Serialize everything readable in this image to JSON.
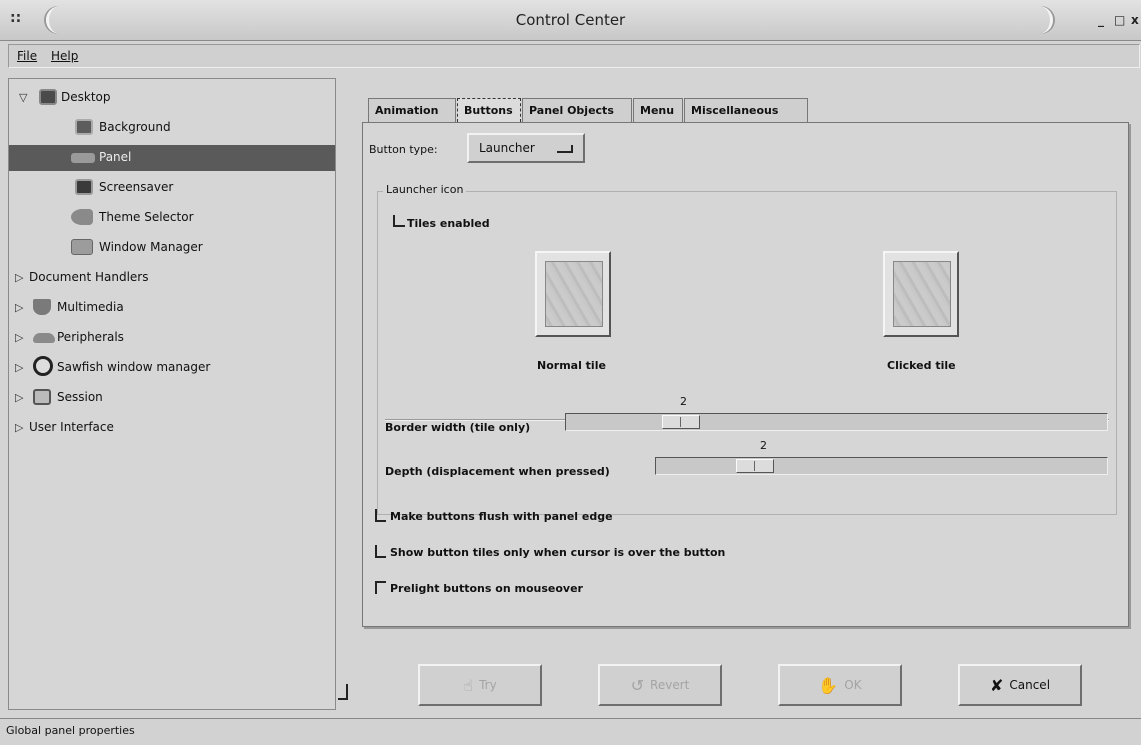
{
  "window": {
    "title": "Control Center",
    "grip": "::",
    "minimize": "_",
    "maximize": "□",
    "close": "x"
  },
  "menu": {
    "file": "File",
    "help": "Help"
  },
  "tree": [
    {
      "label": "Desktop",
      "expander": "▽",
      "icon": "desktop-icon",
      "level": 0
    },
    {
      "label": "Background",
      "icon": "background-icon",
      "level": 1
    },
    {
      "label": "Panel",
      "icon": "panel-icon",
      "level": 1,
      "selected": true
    },
    {
      "label": "Screensaver",
      "icon": "screensaver-icon",
      "level": 1
    },
    {
      "label": "Theme Selector",
      "icon": "theme-icon",
      "level": 1
    },
    {
      "label": "Window Manager",
      "icon": "window-manager-icon",
      "level": 1
    },
    {
      "label": "Document Handlers",
      "expander": "▷",
      "level": 0
    },
    {
      "label": "Multimedia",
      "expander": "▷",
      "icon": "multimedia-icon",
      "level": 0
    },
    {
      "label": "Peripherals",
      "expander": "▷",
      "icon": "peripherals-icon",
      "level": 0
    },
    {
      "label": "Sawfish window manager",
      "expander": "▷",
      "icon": "sawfish-icon",
      "level": 0
    },
    {
      "label": "Session",
      "expander": "▷",
      "icon": "session-icon",
      "level": 0
    },
    {
      "label": "User Interface",
      "expander": "▷",
      "level": 0
    }
  ],
  "tabs": [
    {
      "label": "Animation"
    },
    {
      "label": "Buttons",
      "active": true
    },
    {
      "label": "Panel Objects"
    },
    {
      "label": "Menu"
    },
    {
      "label": "Miscellaneous"
    }
  ],
  "button_type": {
    "label": "Button type:",
    "value": "Launcher"
  },
  "launcher_frame": {
    "title": "Launcher icon",
    "tiles_enabled": "Tiles enabled",
    "normal_tile": "Normal tile",
    "clicked_tile": "Clicked tile"
  },
  "border_width": {
    "label": "Border width (tile only)",
    "value": "2",
    "level": 0.2
  },
  "depth": {
    "label": "Depth (displacement when pressed)",
    "value": "2",
    "level": 0.2
  },
  "options": [
    {
      "label": "Make buttons flush with panel edge",
      "checked": false
    },
    {
      "label": "Show button tiles only when cursor is over the button",
      "checked": false
    },
    {
      "label": "Prelight buttons on mouseover",
      "checked": true
    }
  ],
  "buttons": {
    "try": "Try",
    "revert": "Revert",
    "ok": "OK",
    "cancel": "Cancel"
  },
  "status": "Global panel properties"
}
